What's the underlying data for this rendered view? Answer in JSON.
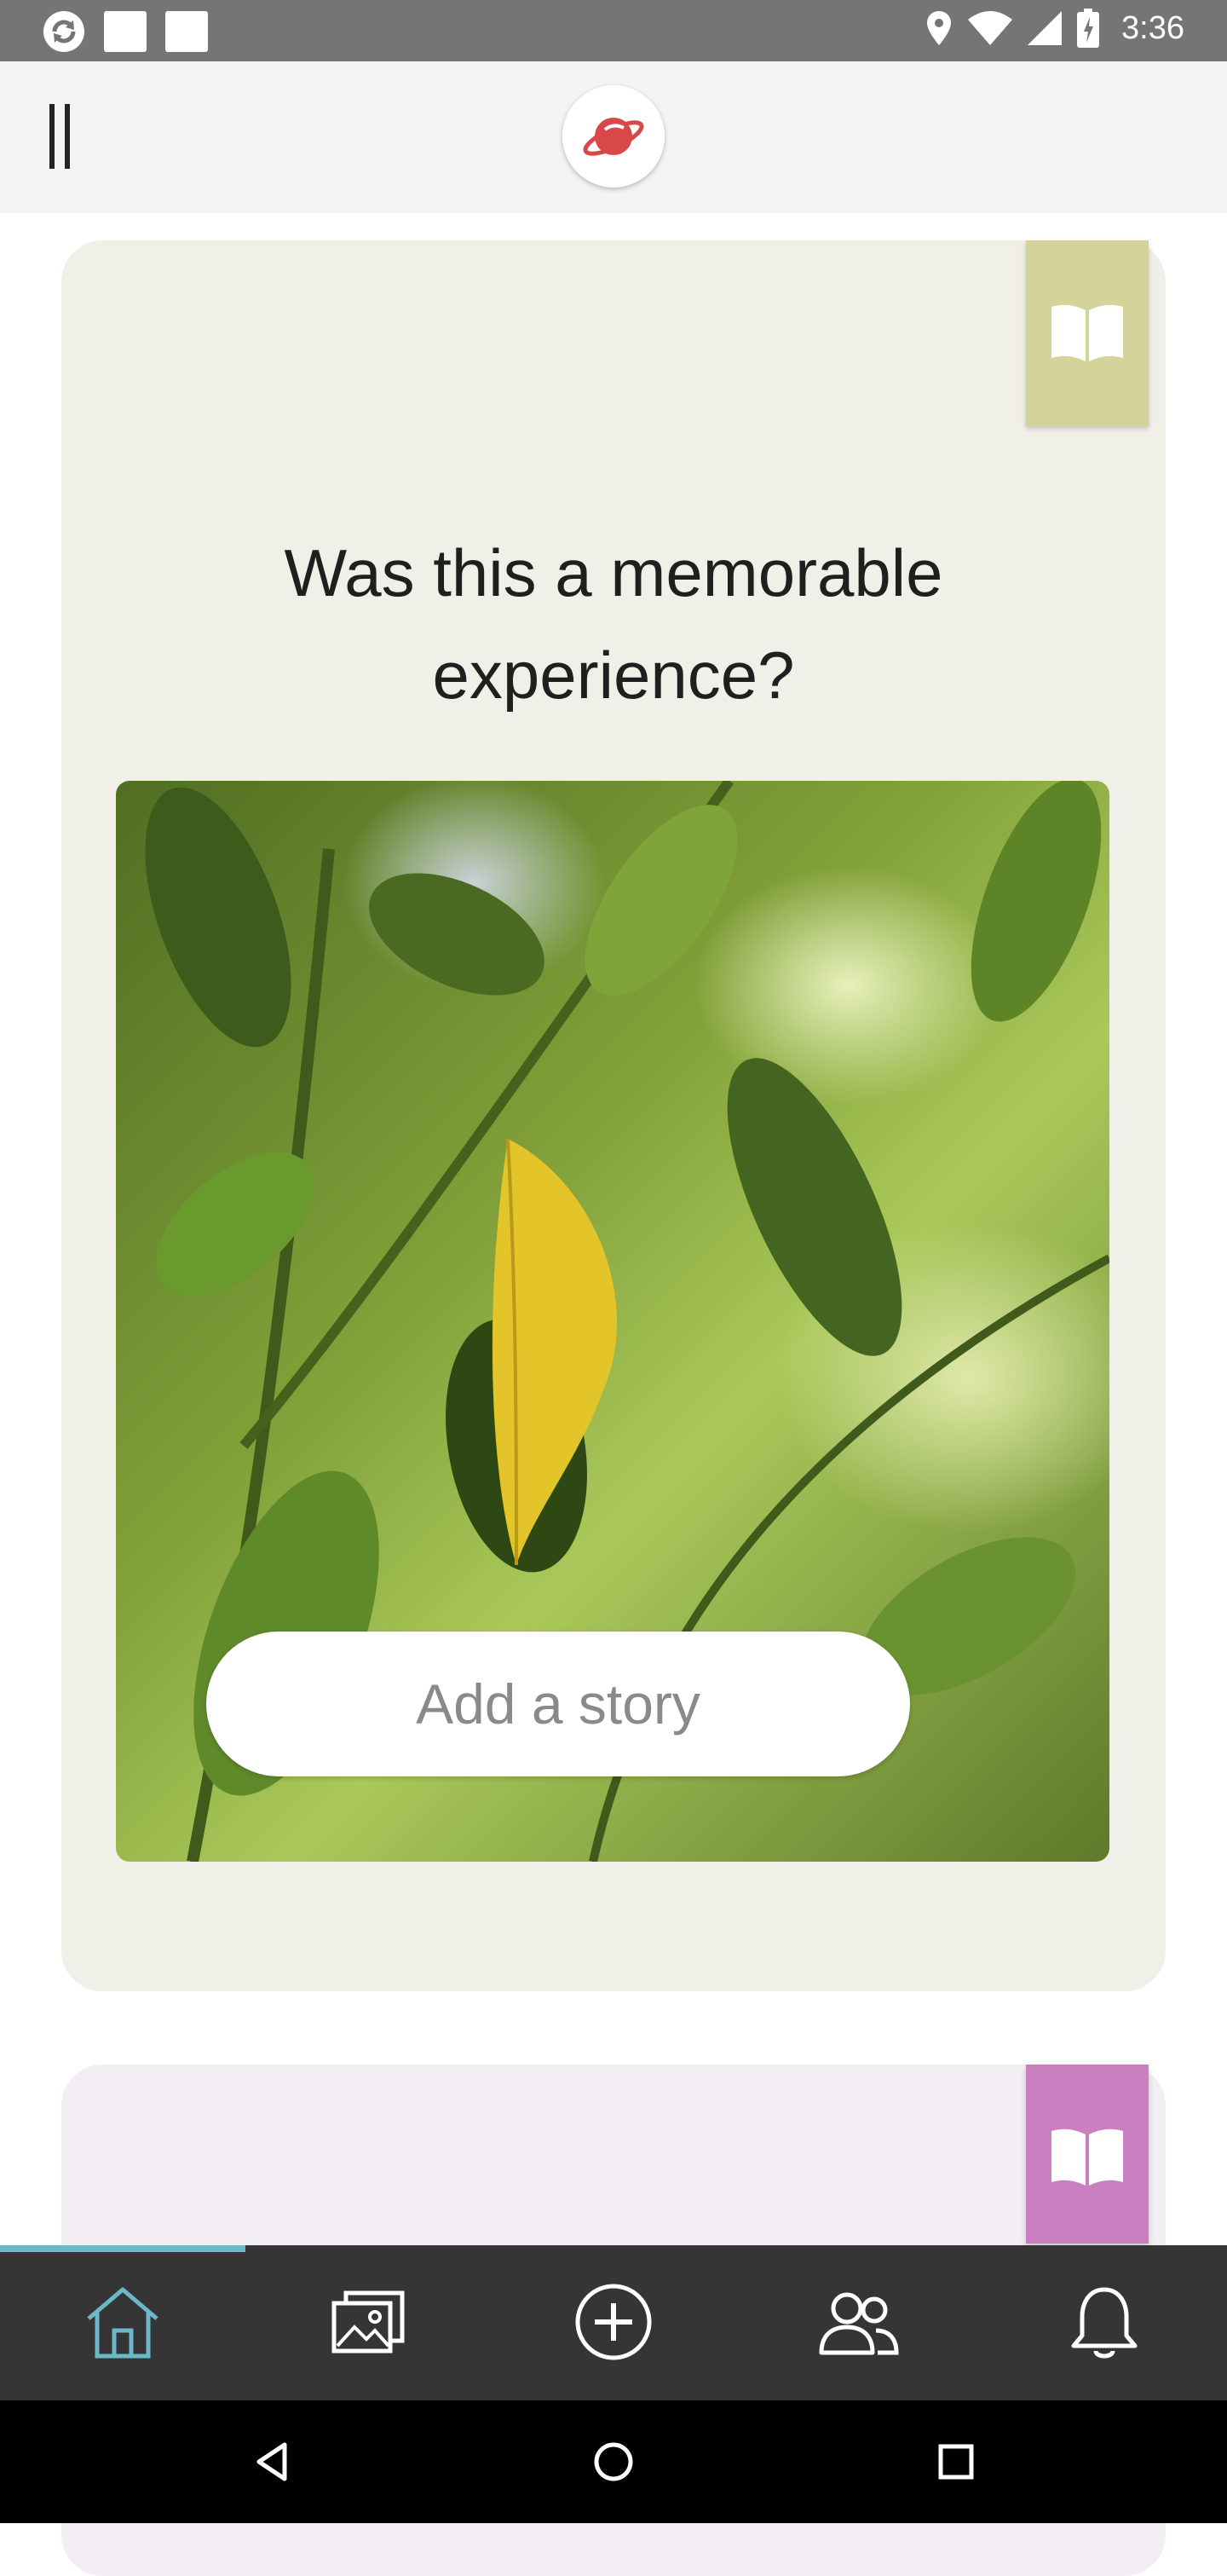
{
  "status_bar": {
    "time": "3:36",
    "left_icons": [
      "sync-icon",
      "notification-square-icon",
      "notification-square-icon"
    ],
    "right_icons": [
      "location-icon",
      "wifi-icon",
      "cell-signal-icon",
      "battery-icon"
    ]
  },
  "header": {
    "menu_icon": "menu-bars-icon",
    "logo_icon": "planet-logo-icon"
  },
  "cards": [
    {
      "bookmark_icon": "open-book-icon",
      "bookmark_color": "#d3d39a",
      "question_line1": "Was this a memorable",
      "question_line2": "experience?",
      "photo_alt": "leaf-photo",
      "add_story_label": "Add a story"
    },
    {
      "bookmark_icon": "open-book-icon",
      "bookmark_color": "#c97fc0"
    }
  ],
  "bottom_nav": {
    "items": [
      "home-icon",
      "gallery-icon",
      "add-circle-icon",
      "people-icon",
      "bell-icon"
    ],
    "active_index": 0,
    "active_color": "#6cb7c8"
  },
  "system_nav": {
    "buttons": [
      "back-icon",
      "home-circle-icon",
      "recents-icon"
    ]
  },
  "colors": {
    "status_bar": "#757575",
    "header_bg": "#f4f4f4",
    "card1_bg": "#f1f0e8",
    "card2_bg": "#f3eef3",
    "nav_bg": "#353535"
  }
}
